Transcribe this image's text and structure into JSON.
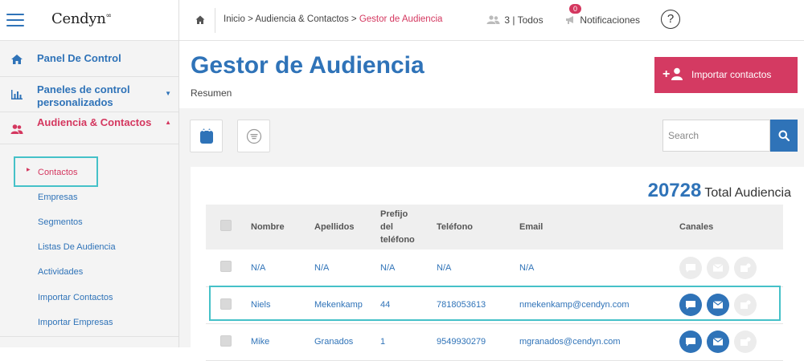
{
  "app": {
    "logo": "Cendyn"
  },
  "sidebar": {
    "items": [
      {
        "label": "Panel De Control"
      },
      {
        "label": "Paneles de control personalizados"
      },
      {
        "label": "Audiencia & Contactos"
      }
    ],
    "sub_items": [
      {
        "label": "Contactos"
      },
      {
        "label": "Empresas"
      },
      {
        "label": "Segmentos"
      },
      {
        "label": "Listas De Audiencia"
      },
      {
        "label": "Actividades"
      },
      {
        "label": "Importar Contactos"
      },
      {
        "label": "Importar Empresas"
      }
    ]
  },
  "topbar": {
    "breadcrumb_home": "Inicio",
    "breadcrumb_mid": "Audiencia & Contactos",
    "breadcrumb_current": "Gestor de Audiencia",
    "breadcrumb_sep": ">",
    "users": "3 | Todos",
    "notif_count": "0",
    "notif_label": "Notificaciones",
    "help": "?"
  },
  "header": {
    "title": "Gestor de Audiencia",
    "subtitle": "Resumen",
    "import_label": "Importar contactos"
  },
  "search": {
    "placeholder": "Search"
  },
  "stats": {
    "total_count": "20728",
    "total_label": "Total Audiencia"
  },
  "table": {
    "headers": {
      "nombre": "Nombre",
      "apellidos": "Apellidos",
      "prefijo_1": "Prefijo",
      "prefijo_2": "del",
      "prefijo_3": "teléfono",
      "telefono": "Teléfono",
      "email": "Email",
      "canales": "Canales"
    },
    "rows": [
      {
        "nombre": "N/A",
        "apellidos": "N/A",
        "prefijo": "N/A",
        "telefono": "N/A",
        "email": "N/A",
        "sms": false,
        "mail": false,
        "push": false
      },
      {
        "nombre": "Niels",
        "apellidos": "Mekenkamp",
        "prefijo": "44",
        "telefono": "7818053613",
        "email": "nmekenkamp@cendyn.com",
        "sms": true,
        "mail": true,
        "push": false
      },
      {
        "nombre": "Mike",
        "apellidos": "Granados",
        "prefijo": "1",
        "telefono": "9549930279",
        "email": "mgranados@cendyn.com",
        "sms": true,
        "mail": true,
        "push": false
      }
    ]
  },
  "colors": {
    "primary": "#2f73b8",
    "accent": "#d4375f",
    "highlight": "#45c1c8"
  }
}
